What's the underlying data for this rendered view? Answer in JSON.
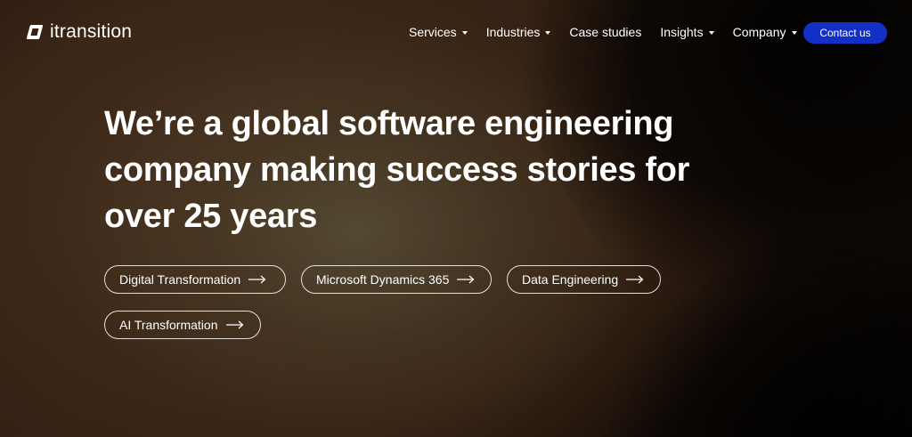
{
  "brand": {
    "name": "itransition",
    "logo_icon": "itransition-mark-icon"
  },
  "nav": {
    "items": [
      {
        "label": "Services",
        "has_dropdown": true
      },
      {
        "label": "Industries",
        "has_dropdown": true
      },
      {
        "label": "Case studies",
        "has_dropdown": false
      },
      {
        "label": "Insights",
        "has_dropdown": true
      },
      {
        "label": "Company",
        "has_dropdown": true
      }
    ],
    "cta_label": "Contact us"
  },
  "hero": {
    "headline_line1": "We’re a global software engineering",
    "headline_line2": "company making success stories for",
    "headline_line3": "over 25 years",
    "pills": [
      {
        "label": "Digital Transformation",
        "icon": "arrow-right-icon"
      },
      {
        "label": "Microsoft Dynamics 365",
        "icon": "arrow-right-icon"
      },
      {
        "label": "Data Engineering",
        "icon": "arrow-right-icon"
      },
      {
        "label": "AI Transformation",
        "icon": "arrow-right-icon"
      }
    ]
  },
  "colors": {
    "cta_background": "#1230c8",
    "text": "#ffffff",
    "background_dark": "#050302",
    "background_warm": "#3a2516"
  }
}
